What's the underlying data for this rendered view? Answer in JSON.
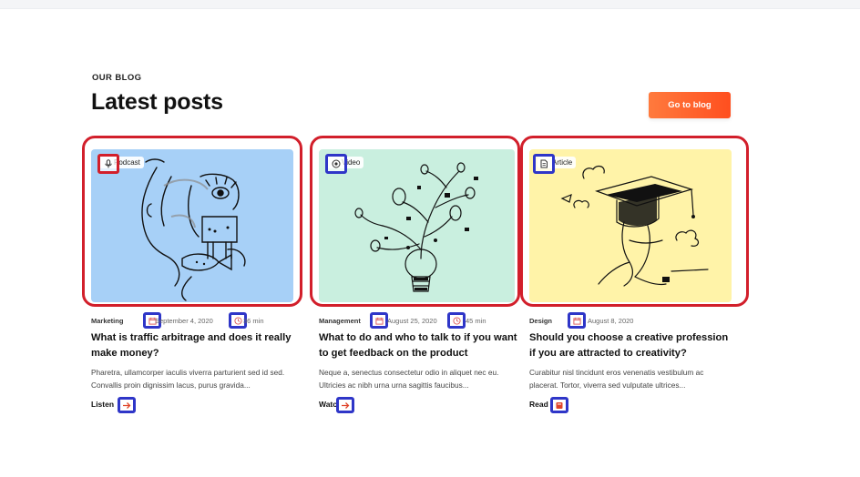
{
  "section": {
    "eyebrow": "OUR BLOG",
    "title": "Latest posts",
    "cta_label": "Go to blog"
  },
  "colors": {
    "accent": "#ff5a24",
    "highlight_red": "#d21f2b",
    "highlight_blue": "#2f36c8"
  },
  "posts": [
    {
      "type": "Podcast",
      "type_icon": "microphone-icon",
      "image_bg": "#a7d0f7",
      "category": "Marketing",
      "date": "September 4, 2020",
      "duration": "36 min",
      "title": "What is traffic arbitrage and does it really make money?",
      "excerpt": "Pharetra, ullamcorper iaculis viverra parturient sed id sed. Convallis proin dignissim lacus, purus gravida...",
      "action": "Listen",
      "action_icon": "arrow-right-icon"
    },
    {
      "type": "Video",
      "type_icon": "play-circle-icon",
      "image_bg": "#c9efdf",
      "category": "Management",
      "date": "August 25, 2020",
      "duration": "45 min",
      "title": "What to do and who to talk to if you want to get feedback on the product",
      "excerpt": "Neque a, senectus consectetur odio in aliquet nec eu. Ultricies ac nibh urna urna sagittis faucibus...",
      "action": "Watch",
      "action_icon": "arrow-right-icon"
    },
    {
      "type": "Article",
      "type_icon": "document-icon",
      "image_bg": "#fff3a8",
      "category": "Design",
      "date": "August 8, 2020",
      "duration": "",
      "title": "Should you choose a creative profession if you are attracted to creativity?",
      "excerpt": "Curabitur nisl tincidunt eros venenatis vestibulum ac placerat. Tortor, viverra sed vulputate ultrices...",
      "action": "Read",
      "action_icon": "book-icon"
    }
  ]
}
